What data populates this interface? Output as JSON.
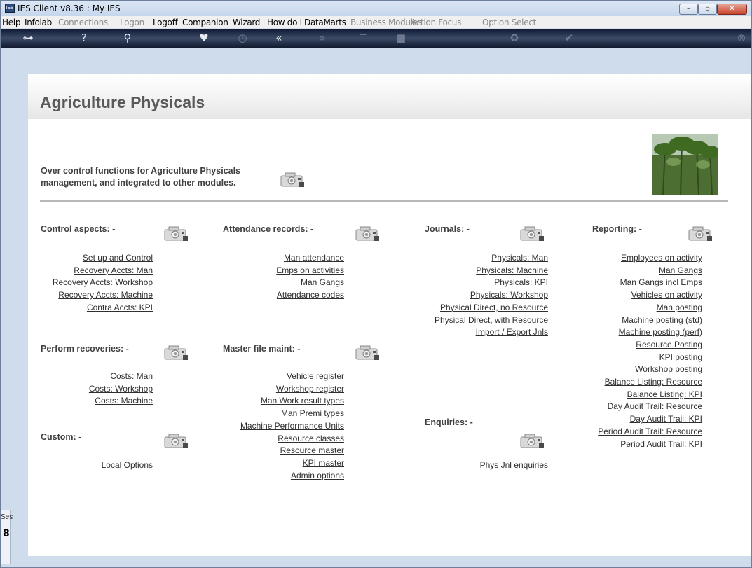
{
  "window": {
    "title": "IES Client v8.36 : My IES",
    "min_glyph": "–",
    "max_glyph": "▫",
    "close_glyph": "✕"
  },
  "menu": [
    {
      "label": "Help",
      "enabled": true
    },
    {
      "label": "Infolab",
      "enabled": true
    },
    {
      "label": "Connections",
      "enabled": false
    },
    {
      "label": "Logon",
      "enabled": false
    },
    {
      "label": "Logoff",
      "enabled": true
    },
    {
      "label": "Companion",
      "enabled": true
    },
    {
      "label": "Wizard",
      "enabled": true
    },
    {
      "label": "How do I",
      "enabled": true
    },
    {
      "label": "DataMarts",
      "enabled": true
    },
    {
      "label": "Business Modules",
      "enabled": false
    },
    {
      "label": "Action Focus",
      "enabled": false
    },
    {
      "label": "Option Select",
      "enabled": false
    }
  ],
  "toolbar": {
    "icons": [
      {
        "name": "key-icon",
        "glyph": "⊶",
        "enabled": true
      },
      {
        "name": "help-icon",
        "glyph": "?",
        "enabled": true
      },
      {
        "name": "search-icon",
        "glyph": "⚲",
        "enabled": true
      },
      {
        "name": "heart-icon",
        "glyph": "♥",
        "enabled": true
      },
      {
        "name": "clock-icon",
        "glyph": "◷",
        "enabled": false
      },
      {
        "name": "back-icon",
        "glyph": "«",
        "enabled": true
      },
      {
        "name": "forward-icon",
        "glyph": "»",
        "enabled": false
      },
      {
        "name": "tree-icon",
        "glyph": "⫪",
        "enabled": false
      },
      {
        "name": "stop-icon",
        "glyph": "■",
        "enabled": false
      },
      {
        "name": "recycle-icon",
        "glyph": "♻",
        "enabled": false
      },
      {
        "name": "check-icon",
        "glyph": "✔",
        "enabled": false
      },
      {
        "name": "exit-icon",
        "glyph": "⊗",
        "enabled": false
      }
    ]
  },
  "page": {
    "title": "Agriculture Physicals",
    "intro_line1": "Over control functions for Agriculture Physicals",
    "intro_line2": "management, and integrated to other modules."
  },
  "sections": {
    "control": {
      "heading": "Control aspects: -",
      "links": [
        "Set up and Control",
        "Recovery Accts: Man",
        "Recovery Accts: Workshop",
        "Recovery Accts: Machine",
        "Contra Accts: KPI"
      ]
    },
    "recoveries": {
      "heading": "Perform recoveries: -",
      "links": [
        "Costs: Man",
        "Costs: Workshop",
        "Costs: Machine"
      ]
    },
    "custom": {
      "heading": "Custom: -",
      "links": [
        "Local Options"
      ]
    },
    "attendance": {
      "heading": "Attendance records: -",
      "links": [
        "Man attendance",
        "Emps on activities",
        "Man Gangs",
        "Attendance codes"
      ]
    },
    "masterfile": {
      "heading": "Master file maint: -",
      "links": [
        "Vehicle register",
        "Workshop register",
        "Man Work result types",
        "Man Premi types",
        "Machine Performance Units",
        "Resource classes",
        "Resource master",
        "KPI master",
        "Admin options"
      ]
    },
    "journals": {
      "heading": "Journals: -",
      "links": [
        "Physicals: Man",
        "Physicals: Machine",
        "Physicals: KPI",
        "Physicals: Workshop",
        "Physical Direct, no Resource",
        "Physical Direct, with Resource",
        "Import / Export Jnls"
      ]
    },
    "enquiries": {
      "heading": "Enquiries: -",
      "links": [
        "Phys Jnl enquiries"
      ]
    },
    "reporting": {
      "heading": "Reporting: -",
      "links": [
        "Employees on activity",
        "Man Gangs",
        "Man Gangs incl Emps",
        "Vehicles on activity",
        "Man posting",
        "Machine posting (std)",
        "Machine posting (perf)",
        "Resource Posting",
        "KPI posting",
        "Workshop posting",
        "Balance Listing: Resource",
        "Balance Listing: KPI",
        "Day Audit Trail: Resource",
        "Day Audit Trail: KPI",
        "Period Audit Trail: Resource",
        "Period Audit Trail: KPI"
      ]
    }
  },
  "side_stub": {
    "label": "Ses",
    "mark": "8"
  }
}
